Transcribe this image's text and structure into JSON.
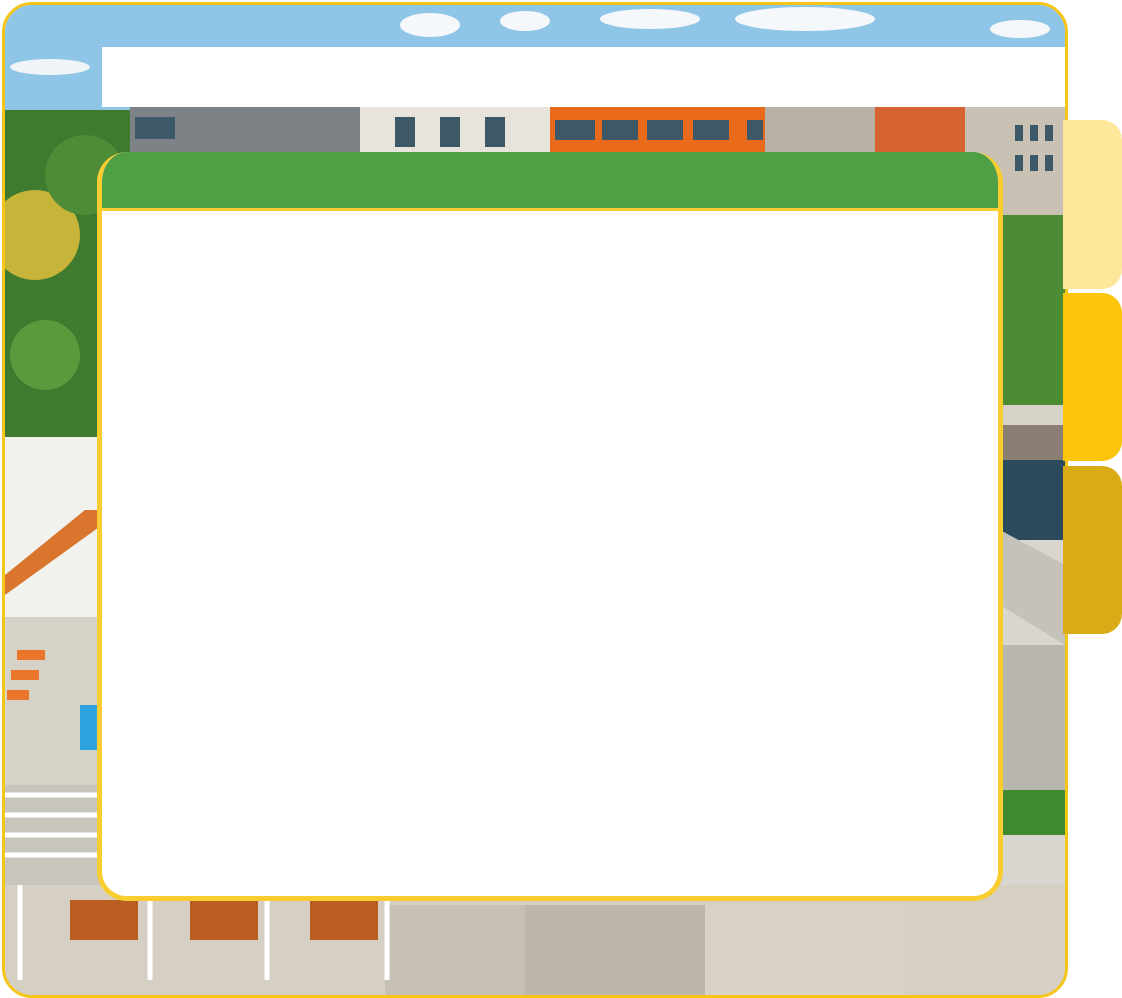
{
  "header": {
    "title": ""
  },
  "panel": {
    "title": "",
    "body": ""
  },
  "tabs": [
    {
      "label": "",
      "color": "#fde79a"
    },
    {
      "label": "",
      "color": "#fbc50b"
    },
    {
      "label": "",
      "color": "#d9ac17"
    }
  ],
  "colors": {
    "frame_border": "#f5c518",
    "panel_header": "#4f9f45",
    "panel_border": "#f9cd2f",
    "background": "#ffffff"
  },
  "background_image": {
    "icon": "campus-aerial-photo"
  }
}
